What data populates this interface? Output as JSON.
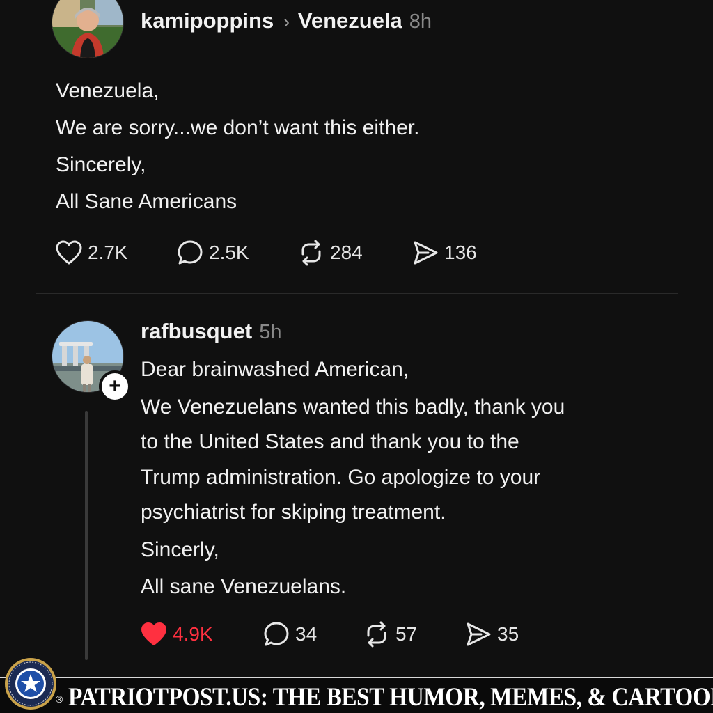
{
  "post": {
    "username": "kamipoppins",
    "community": "Venezuela",
    "time": "8h",
    "lines": [
      "Venezuela,",
      "We are sorry...we don’t want this either.",
      "Sincerely,",
      "All Sane Americans"
    ],
    "likes": "2.7K",
    "replies": "2.5K",
    "reposts": "284",
    "shares": "136"
  },
  "reply": {
    "username": "rafbusquet",
    "time": "5h",
    "follow_symbol": "+",
    "lines": [
      "Dear brainwashed American,",
      "We Venezuelans wanted this badly, thank you",
      "to the United States and thank you to the",
      "Trump administration. Go apologize to your",
      "psychiatrist for skiping treatment.",
      "Sincerly,",
      "All sane Venezuelans."
    ],
    "likes": "4.9K",
    "liked": true,
    "replies": "34",
    "reposts": "57",
    "shares": "35"
  },
  "watermark": {
    "text": "PATRIOTPOST.US: THE BEST HUMOR, MEMES, & CARTOONS",
    "registered": "®"
  },
  "colors": {
    "background": "#101010",
    "liked": "#ff3040",
    "muted": "#8a8a8a"
  },
  "icons": {
    "like": "heart-icon",
    "reply": "comment-bubble-icon",
    "repost": "repost-arrows-icon",
    "share": "send-icon"
  }
}
